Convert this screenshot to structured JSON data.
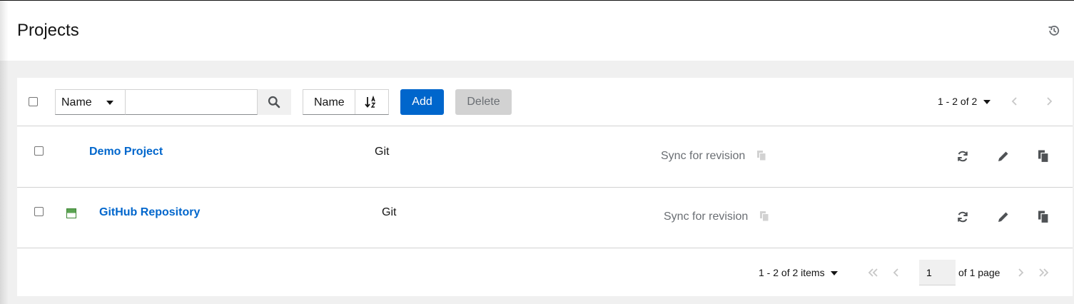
{
  "page": {
    "title": "Projects",
    "history_icon": "history-icon"
  },
  "toolbar": {
    "filter_field": "Name",
    "search_value": "",
    "search_icon": "search-icon",
    "sort_field": "Name",
    "sort_icon": "sort-alpha-down-icon",
    "add_label": "Add",
    "delete_label": "Delete",
    "pagination_label": "1 - 2 of 2"
  },
  "rows": [
    {
      "name": "Demo Project",
      "scm_type": "Git",
      "revision": "Sync for revision",
      "has_status": false
    },
    {
      "name": "GitHub Repository",
      "scm_type": "Git",
      "revision": "Sync for revision",
      "has_status": true,
      "status_icon": "job-status-icon"
    }
  ],
  "row_actions": [
    "sync-icon",
    "edit-icon",
    "copy-icon"
  ],
  "footer": {
    "count_label": "1 - 2 of 2 items",
    "page_value": "1",
    "pages_label": "of 1 page"
  },
  "colors": {
    "link": "#0066cc",
    "primary": "#0066cc",
    "status_success": "#5ba352"
  }
}
